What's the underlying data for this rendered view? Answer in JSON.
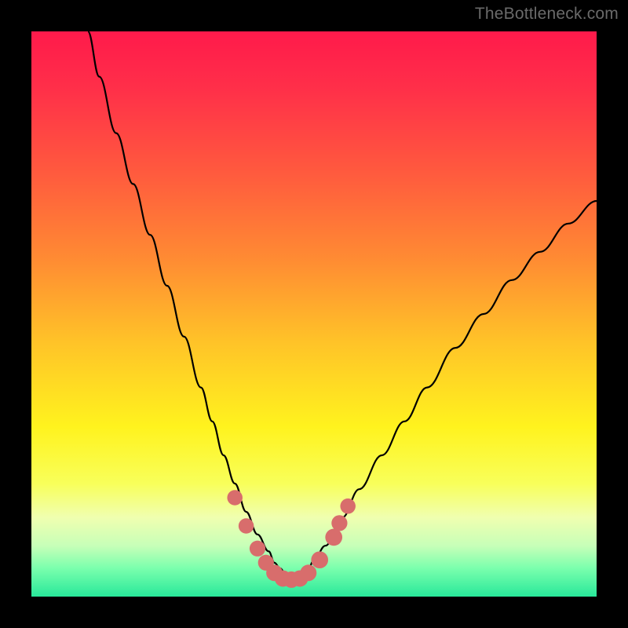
{
  "watermark": "TheBottleneck.com",
  "colors": {
    "frame": "#000000",
    "curve": "#000000",
    "marker": "#d86d6c",
    "gradient_stops": [
      {
        "offset": 0.0,
        "color": "#ff1a4b"
      },
      {
        "offset": 0.1,
        "color": "#ff2f49"
      },
      {
        "offset": 0.25,
        "color": "#ff5a3e"
      },
      {
        "offset": 0.4,
        "color": "#ff8a33"
      },
      {
        "offset": 0.55,
        "color": "#ffc328"
      },
      {
        "offset": 0.7,
        "color": "#fff31e"
      },
      {
        "offset": 0.8,
        "color": "#f8ff5a"
      },
      {
        "offset": 0.86,
        "color": "#f0ffb0"
      },
      {
        "offset": 0.91,
        "color": "#c7ffb8"
      },
      {
        "offset": 0.95,
        "color": "#7affad"
      },
      {
        "offset": 1.0,
        "color": "#28e89a"
      }
    ]
  },
  "chart_data": {
    "type": "line",
    "title": "",
    "xlabel": "",
    "ylabel": "",
    "xlim": [
      0,
      100
    ],
    "ylim": [
      0,
      100
    ],
    "series": [
      {
        "name": "bottleneck-curve",
        "x": [
          10,
          12,
          15,
          18,
          21,
          24,
          27,
          30,
          32,
          34,
          36,
          38,
          40,
          42,
          43,
          44,
          45,
          46,
          47,
          48,
          49,
          50,
          52,
          55,
          58,
          62,
          66,
          70,
          75,
          80,
          85,
          90,
          95,
          100
        ],
        "y": [
          100,
          92,
          82,
          73,
          64,
          55,
          46,
          37,
          31,
          25,
          20,
          15,
          11,
          8,
          6,
          5,
          4,
          3.5,
          3.5,
          4,
          5,
          6.5,
          9,
          14,
          19,
          25,
          31,
          37,
          44,
          50,
          56,
          61,
          66,
          70
        ]
      }
    ],
    "markers": [
      {
        "x": 36,
        "y": 17.5,
        "r": 1.6
      },
      {
        "x": 38,
        "y": 12.5,
        "r": 1.6
      },
      {
        "x": 40,
        "y": 8.5,
        "r": 1.7
      },
      {
        "x": 41.5,
        "y": 6,
        "r": 1.7
      },
      {
        "x": 43,
        "y": 4.2,
        "r": 1.8
      },
      {
        "x": 44.5,
        "y": 3.2,
        "r": 1.8
      },
      {
        "x": 46,
        "y": 3.0,
        "r": 1.8
      },
      {
        "x": 47.5,
        "y": 3.2,
        "r": 1.8
      },
      {
        "x": 49,
        "y": 4.2,
        "r": 1.8
      },
      {
        "x": 51,
        "y": 6.5,
        "r": 1.9
      },
      {
        "x": 53.5,
        "y": 10.5,
        "r": 1.9
      },
      {
        "x": 54.5,
        "y": 13,
        "r": 1.7
      },
      {
        "x": 56,
        "y": 16,
        "r": 1.6
      }
    ]
  }
}
